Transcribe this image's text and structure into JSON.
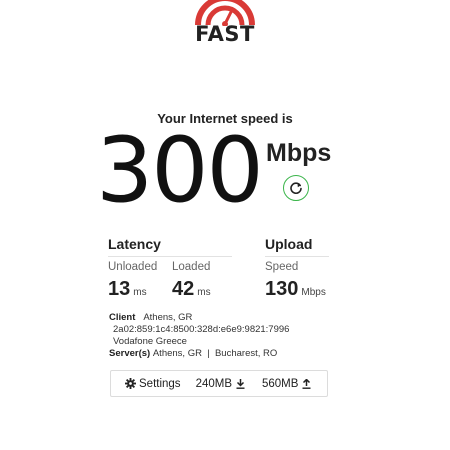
{
  "logo": {
    "text": "FAST",
    "name": "fast-logo",
    "color": "#d93a36"
  },
  "speed": {
    "label": "Your Internet speed is",
    "value": "300",
    "units": "Mbps"
  },
  "refresh": {
    "icon": "refresh-icon",
    "color": "#3ab54a"
  },
  "latency": {
    "title": "Latency",
    "unloaded": {
      "label": "Unloaded",
      "value": "13",
      "unit": "ms"
    },
    "loaded": {
      "label": "Loaded",
      "value": "42",
      "unit": "ms"
    }
  },
  "upload": {
    "title": "Upload",
    "speed": {
      "label": "Speed",
      "value": "130",
      "unit": "Mbps"
    }
  },
  "client": {
    "label": "Client",
    "location": "Athens, GR",
    "ip": "2a02:859:1c4:8500:328d:e6e9:9821:7996",
    "isp": "Vodafone Greece"
  },
  "servers": {
    "label": "Server(s)",
    "locations": "Athens, GR  |  Bucharest, RO"
  },
  "settings_bar": {
    "settings_label": "Settings",
    "settings_icon": "gear-icon",
    "download_data": "240MB",
    "download_icon": "download-icon",
    "upload_data": "560MB",
    "upload_icon": "upload-icon"
  }
}
